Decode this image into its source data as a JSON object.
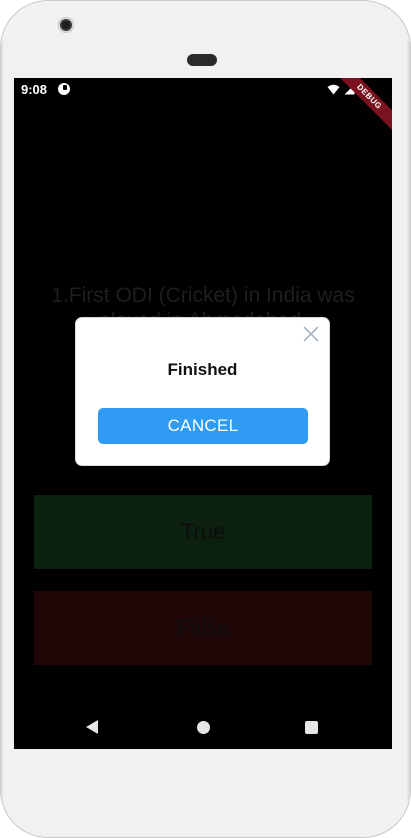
{
  "status_bar": {
    "time": "9:08",
    "debug_banner": "DEBUG"
  },
  "quiz": {
    "question": "1.First ODI (Cricket) in India was played in Ahmedabad.",
    "true_label": "True",
    "false_label": "False"
  },
  "dialog": {
    "title": "Finished",
    "cancel_label": "CANCEL"
  },
  "colors": {
    "accent_button": "#2f9bf4",
    "true_button_dimmed": "#0c200f",
    "false_button_dimmed": "#1f0707",
    "debug_banner": "#7a1220"
  },
  "icons": [
    "camera-icon",
    "app-status-icon",
    "wifi-icon",
    "signal-icon",
    "battery-icon",
    "close-icon",
    "back-icon",
    "home-icon",
    "recents-icon"
  ]
}
